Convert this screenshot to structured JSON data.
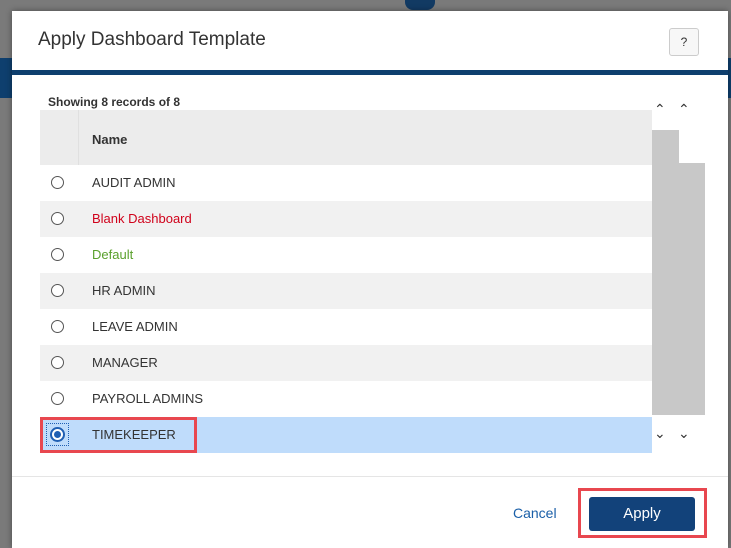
{
  "dialog": {
    "title": "Apply Dashboard Template",
    "help_label": "?"
  },
  "grid": {
    "records_text": "Showing 8 records of 8",
    "column_header": "Name",
    "rows": [
      {
        "label": "AUDIT ADMIN",
        "color": "#333333",
        "selected": false
      },
      {
        "label": "Blank Dashboard",
        "color": "#d0021b",
        "selected": false
      },
      {
        "label": "Default",
        "color": "#5aa02c",
        "selected": false
      },
      {
        "label": "HR ADMIN",
        "color": "#333333",
        "selected": false
      },
      {
        "label": "LEAVE ADMIN",
        "color": "#333333",
        "selected": false
      },
      {
        "label": "MANAGER",
        "color": "#333333",
        "selected": false
      },
      {
        "label": "PAYROLL ADMINS",
        "color": "#333333",
        "selected": false
      },
      {
        "label": "TIMEKEEPER",
        "color": "#333333",
        "selected": true
      }
    ]
  },
  "scrollbar": {
    "up_icon": "chevron-up-icon",
    "down_icon": "chevron-down-icon"
  },
  "footer": {
    "cancel_label": "Cancel",
    "apply_label": "Apply"
  },
  "colors": {
    "accent": "#0e3f6e",
    "highlight": "#e8474f",
    "selected_row": "#bfdcfb"
  }
}
